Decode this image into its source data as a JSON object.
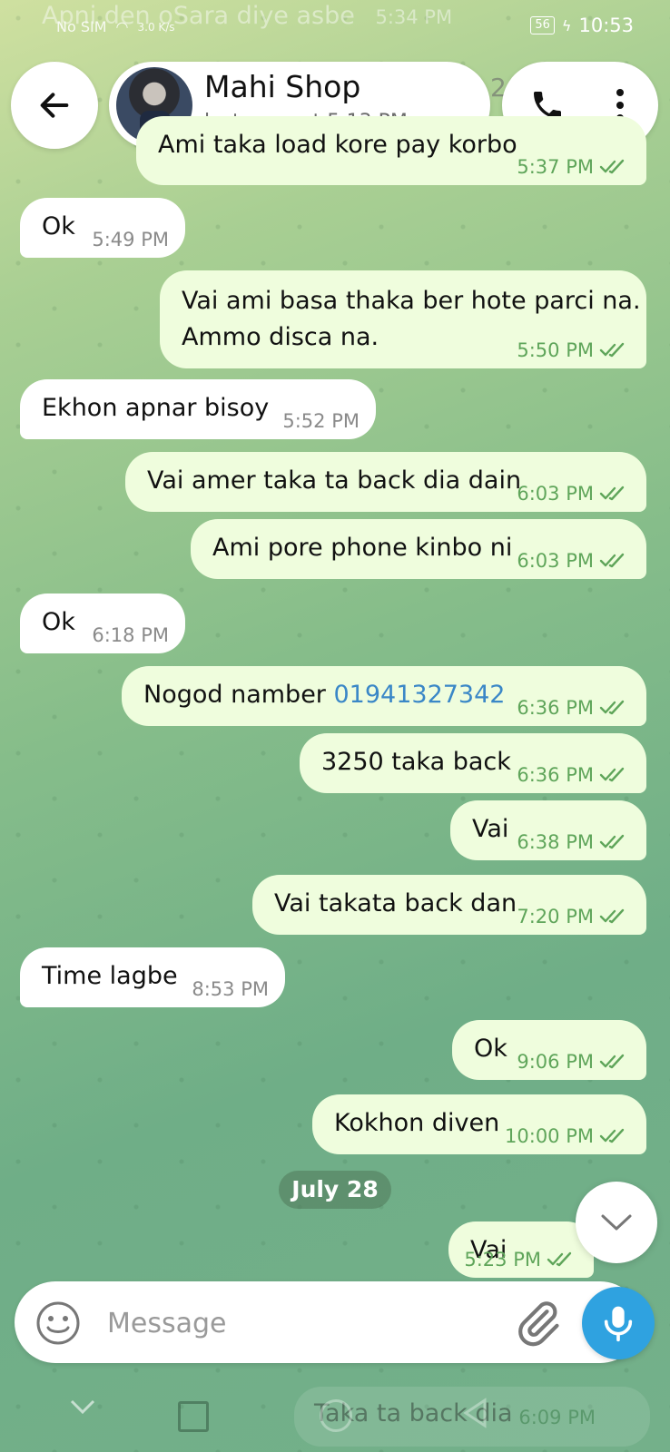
{
  "status": {
    "sim": "No SIM",
    "net_speed": "3.0 K/s",
    "battery": "56",
    "clock": "10:53"
  },
  "ghosts": {
    "top_text": "Apni den oSara diye asbe",
    "top_time": "5:34 PM",
    "bottom_text": "Taka ta back dia",
    "bottom_time": "6:09 PM",
    "header_peek": "2"
  },
  "header": {
    "name": "Mahi Shop",
    "last_seen": "last seen at 5:13 PM"
  },
  "messages": [
    {
      "dir": "out",
      "text": "Ami taka load kore pay korbo",
      "time": "5:37 PM"
    },
    {
      "dir": "in",
      "text": "Ok",
      "time": "5:49 PM"
    },
    {
      "dir": "out",
      "text": "Vai ami basa thaka ber hote parci na.\nAmmo disca na.",
      "time": "5:50 PM"
    },
    {
      "dir": "in",
      "text": "Ekhon apnar bisoy",
      "time": "5:52 PM"
    },
    {
      "dir": "out",
      "text": "Vai amer taka ta back dia dain",
      "time": "6:03 PM"
    },
    {
      "dir": "out",
      "text": "Ami pore phone kinbo ni",
      "time": "6:03 PM"
    },
    {
      "dir": "in",
      "text": "Ok",
      "time": "6:18 PM"
    },
    {
      "dir": "out",
      "text": "Nogod namber ",
      "link": "01941327342",
      "time": "6:36 PM"
    },
    {
      "dir": "out",
      "text": "3250 taka back",
      "time": "6:36 PM"
    },
    {
      "dir": "out",
      "text": "Vai",
      "time": "6:38 PM"
    },
    {
      "dir": "out",
      "text": "Vai takata back dan",
      "time": "7:20 PM"
    },
    {
      "dir": "in",
      "text": "Time lagbe",
      "time": "8:53 PM"
    },
    {
      "dir": "out",
      "text": "Ok",
      "time": "9:06 PM"
    },
    {
      "dir": "out",
      "text": "Kokhon diven",
      "time": "10:00 PM"
    },
    {
      "dir": "out",
      "text": "Vai",
      "time": "5:23 PM"
    }
  ],
  "date_divider": "July 28",
  "composer": {
    "placeholder": "Message"
  },
  "icons": [
    "back-arrow-icon",
    "phone-icon",
    "more-vert-icon",
    "chevron-down-icon",
    "emoji-icon",
    "attach-icon",
    "mic-icon",
    "double-check-icon"
  ],
  "colors": {
    "outgoing_bubble": "#effddd",
    "incoming_bubble": "#ffffff",
    "accent": "#2fa2e0",
    "tick_green": "#5fa55a"
  }
}
